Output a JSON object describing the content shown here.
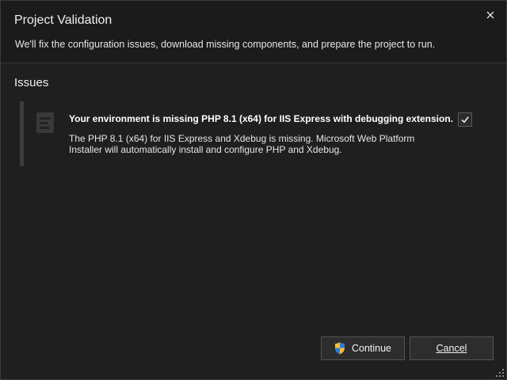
{
  "dialog": {
    "title": "Project Validation",
    "subtitle": "We'll fix the configuration issues, download missing components, and prepare the project to run.",
    "close_icon": "close-icon"
  },
  "issues_section": {
    "heading": "Issues",
    "items": [
      {
        "icon": "php-icon",
        "title": "Your environment is missing PHP 8.1 (x64) for IIS Express with debugging extension.",
        "description": "The PHP 8.1 (x64) for IIS Express and Xdebug is missing. Microsoft Web Platform Installer will automatically install and configure PHP and Xdebug.",
        "checked": true
      }
    ]
  },
  "footer": {
    "continue_label": "Continue",
    "continue_icon": "uac-shield-icon",
    "cancel_label": "Cancel"
  },
  "colors": {
    "background": "#1f1f1f",
    "header_background": "#1b1b1b",
    "button_background": "#2d2d2d",
    "text": "#f1f1f1"
  }
}
